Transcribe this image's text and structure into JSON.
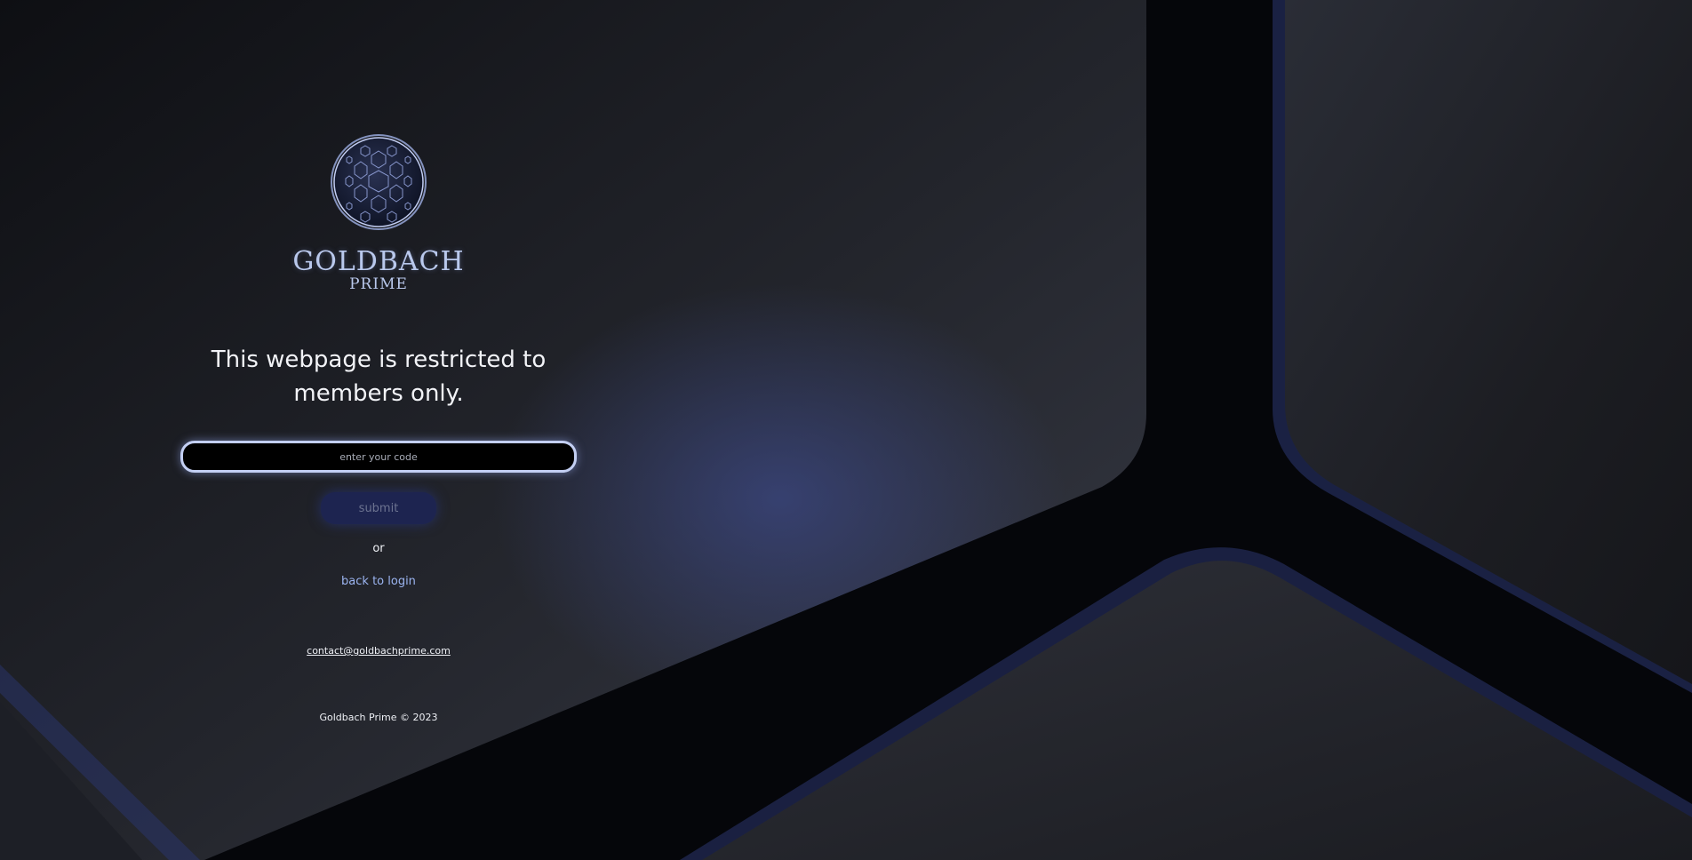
{
  "brand": {
    "name_main": "GOLDBACH",
    "name_sub": "PRIME",
    "emblem_icon": "hexagon-sphere-icon"
  },
  "headline": "This webpage is restricted to members only.",
  "code_field": {
    "placeholder": "enter your code",
    "value": ""
  },
  "submit_label": "submit",
  "or_label": "or",
  "back_to_login_label": "back to login",
  "contact_email": "contact@goldbachprime.com",
  "copyright": "Goldbach Prime © 2023",
  "colors": {
    "brand_accent": "#b9c8ec",
    "link": "#9bb4f0",
    "submit_bg": "#1d2450",
    "input_border": "#c3cff3"
  }
}
